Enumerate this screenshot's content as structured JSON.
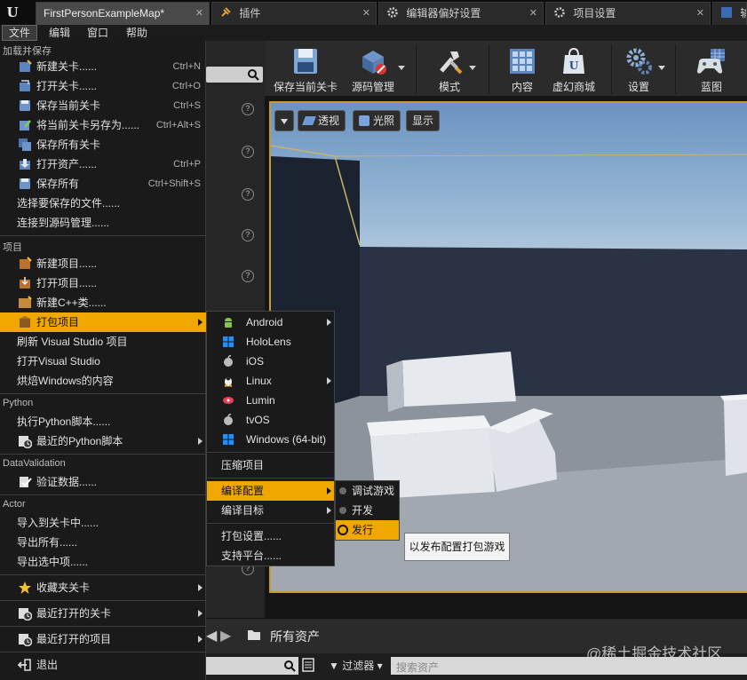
{
  "tabs": [
    {
      "label": "FirstPersonExampleMap*",
      "active": true
    },
    {
      "label": "插件"
    },
    {
      "label": "编辑器偏好设置"
    },
    {
      "label": "项目设置"
    },
    {
      "label": "输"
    }
  ],
  "menubar": [
    "文件",
    "编辑",
    "窗口",
    "帮助"
  ],
  "toolbar": [
    {
      "label": "保存当前关卡",
      "icon": "floppy-icon"
    },
    {
      "label": "源码管理",
      "icon": "source-control-icon"
    },
    {
      "label": "模式",
      "icon": "modes-tools-icon"
    },
    {
      "label": "内容",
      "icon": "content-grid-icon"
    },
    {
      "label": "虚幻商城",
      "icon": "marketplace-bag-icon"
    },
    {
      "label": "设置",
      "icon": "settings-gears-icon"
    },
    {
      "label": "蓝图",
      "icon": "blueprint-gamepad-icon"
    }
  ],
  "viewport": {
    "perspective": "透视",
    "lighting": "光照",
    "show": "显示"
  },
  "file_menu": {
    "sections": {
      "load_save": "加载并保存",
      "project": "项目",
      "python": "Python",
      "datavalidation": "DataValidation",
      "actor": "Actor"
    },
    "load_save_items": [
      {
        "label": "新建关卡......",
        "shortcut": "Ctrl+N"
      },
      {
        "label": "打开关卡......",
        "shortcut": "Ctrl+O"
      },
      {
        "label": "保存当前关卡",
        "shortcut": "Ctrl+S"
      },
      {
        "label": "将当前关卡另存为......",
        "shortcut": "Ctrl+Alt+S"
      },
      {
        "label": "保存所有关卡",
        "shortcut": ""
      },
      {
        "label": "打开资产......",
        "shortcut": "Ctrl+P"
      },
      {
        "label": "保存所有",
        "shortcut": "Ctrl+Shift+S"
      },
      {
        "label": "选择要保存的文件......",
        "shortcut": ""
      },
      {
        "label": "连接到源码管理......",
        "shortcut": ""
      }
    ],
    "project_items": [
      {
        "label": "新建项目......"
      },
      {
        "label": "打开项目......"
      },
      {
        "label": "新建C++类......"
      },
      {
        "label": "打包项目"
      },
      {
        "label": "刷新 Visual Studio 项目"
      },
      {
        "label": "打开Visual Studio"
      },
      {
        "label": "烘焙Windows的内容"
      }
    ],
    "python_items": [
      {
        "label": "执行Python脚本......"
      },
      {
        "label": "最近的Python脚本"
      }
    ],
    "datavalidation_items": [
      {
        "label": "验证数据......"
      }
    ],
    "actor_items": [
      {
        "label": "导入到关卡中......"
      },
      {
        "label": "导出所有......"
      },
      {
        "label": "导出选中项......"
      }
    ],
    "bottom_items": [
      {
        "label": "收藏夹关卡"
      },
      {
        "label": "最近打开的关卡"
      },
      {
        "label": "最近打开的项目"
      },
      {
        "label": "退出"
      }
    ]
  },
  "package_menu": {
    "platforms": [
      "Android",
      "HoloLens",
      "iOS",
      "Linux",
      "Lumin",
      "tvOS",
      "Windows (64-bit)"
    ],
    "zip": "压缩项目",
    "build_config": "编译配置",
    "build_target": "编译目标",
    "package_settings": "打包设置......",
    "supported_platforms": "支持平台......"
  },
  "config_menu": [
    "调试游戏",
    "开发",
    "发行"
  ],
  "tooltip": "以发布配置打包游戏",
  "content_browser": {
    "all_assets": "所有资产",
    "filters": "过滤器",
    "search_placeholder": "搜索资产"
  },
  "watermark": "@稀土掘金技术社区",
  "colors": {
    "highlight": "#f0a700",
    "viewport_border": "#c69a2c"
  }
}
